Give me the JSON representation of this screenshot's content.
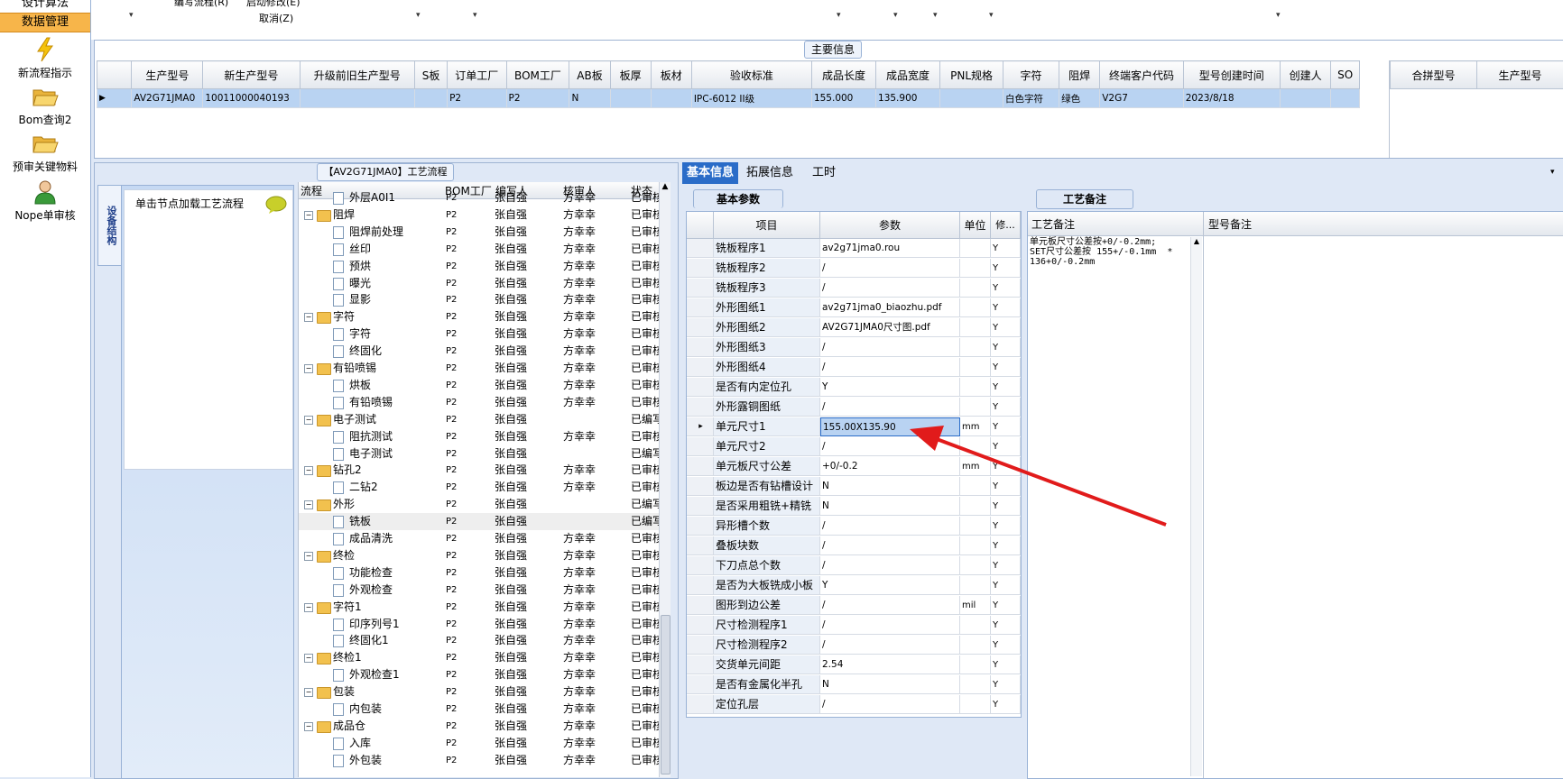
{
  "leftnav": {
    "top_item": "设计算法",
    "active_item": "数据管理",
    "items": [
      {
        "label": "新流程指示",
        "icon": "lightning-icon"
      },
      {
        "label": "Bom查询2",
        "icon": "folder-open-icon"
      },
      {
        "label": "预审关键物料",
        "icon": "folder-open-icon"
      },
      {
        "label": "Nope单审核",
        "icon": "user-icon"
      }
    ]
  },
  "toolbar": {
    "edit_process": "编写流程(R)",
    "start_modify": "启动修改(E)",
    "cancel": "取消(Z)"
  },
  "main_info": {
    "title": "主要信息",
    "columns": [
      "生产型号",
      "新生产型号",
      "升级前旧生产型号",
      "S板",
      "订单工厂",
      "BOM工厂",
      "AB板",
      "板厚",
      "板材",
      "验收标准",
      "成品长度",
      "成品宽度",
      "PNL规格",
      "字符",
      "阻焊",
      "终端客户代码",
      "型号创建时间",
      "创建人",
      "SO"
    ],
    "row": [
      "AV2G71JMA0",
      "10011000040193",
      "",
      "",
      "P2",
      "P2",
      "N",
      "",
      "",
      "IPC-6012 II级",
      "155.000",
      "135.900",
      "",
      "白色字符",
      "绿色",
      "V2G7",
      "2023/8/18",
      "",
      ""
    ],
    "side_columns": [
      "合拼型号",
      "生产型号"
    ]
  },
  "process_panel": {
    "title": "【AV2G71JMA0】工艺流程",
    "device_tab": "设备结构",
    "device_hint": "单击节点加载工艺流程",
    "columns": [
      "流程",
      "BOM工厂",
      "编写人",
      "核审人",
      "状态"
    ],
    "rows": [
      {
        "level": 2,
        "type": "doc",
        "name": "外层A0I1",
        "factory": "P2",
        "writer": "张自强",
        "reviewer": "方幸幸",
        "status": "已审核"
      },
      {
        "level": 1,
        "type": "folder",
        "name": "阻焊",
        "factory": "P2",
        "writer": "张自强",
        "reviewer": "方幸幸",
        "status": "已审核"
      },
      {
        "level": 2,
        "type": "doc",
        "name": "阻焊前处理",
        "factory": "P2",
        "writer": "张自强",
        "reviewer": "方幸幸",
        "status": "已审核"
      },
      {
        "level": 2,
        "type": "doc",
        "name": "丝印",
        "factory": "P2",
        "writer": "张自强",
        "reviewer": "方幸幸",
        "status": "已审核"
      },
      {
        "level": 2,
        "type": "doc",
        "name": "预烘",
        "factory": "P2",
        "writer": "张自强",
        "reviewer": "方幸幸",
        "status": "已审核"
      },
      {
        "level": 2,
        "type": "doc",
        "name": "曝光",
        "factory": "P2",
        "writer": "张自强",
        "reviewer": "方幸幸",
        "status": "已审核"
      },
      {
        "level": 2,
        "type": "doc",
        "name": "显影",
        "factory": "P2",
        "writer": "张自强",
        "reviewer": "方幸幸",
        "status": "已审核"
      },
      {
        "level": 1,
        "type": "folder",
        "name": "字符",
        "factory": "P2",
        "writer": "张自强",
        "reviewer": "方幸幸",
        "status": "已审核"
      },
      {
        "level": 2,
        "type": "doc",
        "name": "字符",
        "factory": "P2",
        "writer": "张自强",
        "reviewer": "方幸幸",
        "status": "已审核"
      },
      {
        "level": 2,
        "type": "doc",
        "name": "终固化",
        "factory": "P2",
        "writer": "张自强",
        "reviewer": "方幸幸",
        "status": "已审核"
      },
      {
        "level": 1,
        "type": "folder",
        "name": "有铅喷锡",
        "factory": "P2",
        "writer": "张自强",
        "reviewer": "方幸幸",
        "status": "已审核"
      },
      {
        "level": 2,
        "type": "doc",
        "name": "烘板",
        "factory": "P2",
        "writer": "张自强",
        "reviewer": "方幸幸",
        "status": "已审核"
      },
      {
        "level": 2,
        "type": "doc",
        "name": "有铅喷锡",
        "factory": "P2",
        "writer": "张自强",
        "reviewer": "方幸幸",
        "status": "已审核"
      },
      {
        "level": 1,
        "type": "folder",
        "name": "电子测试",
        "factory": "P2",
        "writer": "张自强",
        "reviewer": "",
        "status": "已编写"
      },
      {
        "level": 2,
        "type": "doc",
        "name": "阻抗测试",
        "factory": "P2",
        "writer": "张自强",
        "reviewer": "方幸幸",
        "status": "已审核"
      },
      {
        "level": 2,
        "type": "doc",
        "name": "电子测试",
        "factory": "P2",
        "writer": "张自强",
        "reviewer": "",
        "status": "已编写"
      },
      {
        "level": 1,
        "type": "folder",
        "name": "钻孔2",
        "factory": "P2",
        "writer": "张自强",
        "reviewer": "方幸幸",
        "status": "已审核"
      },
      {
        "level": 2,
        "type": "doc",
        "name": "二钻2",
        "factory": "P2",
        "writer": "张自强",
        "reviewer": "方幸幸",
        "status": "已审核"
      },
      {
        "level": 1,
        "type": "folder",
        "name": "外形",
        "factory": "P2",
        "writer": "张自强",
        "reviewer": "",
        "status": "已编写"
      },
      {
        "level": 2,
        "type": "doc",
        "name": "铣板",
        "factory": "P2",
        "writer": "张自强",
        "reviewer": "",
        "status": "已编写"
      },
      {
        "level": 2,
        "type": "doc",
        "name": "成品清洗",
        "factory": "P2",
        "writer": "张自强",
        "reviewer": "方幸幸",
        "status": "已审核"
      },
      {
        "level": 1,
        "type": "folder",
        "name": "终检",
        "factory": "P2",
        "writer": "张自强",
        "reviewer": "方幸幸",
        "status": "已审核"
      },
      {
        "level": 2,
        "type": "doc",
        "name": "功能检查",
        "factory": "P2",
        "writer": "张自强",
        "reviewer": "方幸幸",
        "status": "已审核"
      },
      {
        "level": 2,
        "type": "doc",
        "name": "外观检查",
        "factory": "P2",
        "writer": "张自强",
        "reviewer": "方幸幸",
        "status": "已审核"
      },
      {
        "level": 1,
        "type": "folder",
        "name": "字符1",
        "factory": "P2",
        "writer": "张自强",
        "reviewer": "方幸幸",
        "status": "已审核"
      },
      {
        "level": 2,
        "type": "doc",
        "name": "印序列号1",
        "factory": "P2",
        "writer": "张自强",
        "reviewer": "方幸幸",
        "status": "已审核"
      },
      {
        "level": 2,
        "type": "doc",
        "name": "终固化1",
        "factory": "P2",
        "writer": "张自强",
        "reviewer": "方幸幸",
        "status": "已审核"
      },
      {
        "level": 1,
        "type": "folder",
        "name": "终检1",
        "factory": "P2",
        "writer": "张自强",
        "reviewer": "方幸幸",
        "status": "已审核"
      },
      {
        "level": 2,
        "type": "doc",
        "name": "外观检查1",
        "factory": "P2",
        "writer": "张自强",
        "reviewer": "方幸幸",
        "status": "已审核"
      },
      {
        "level": 1,
        "type": "folder",
        "name": "包装",
        "factory": "P2",
        "writer": "张自强",
        "reviewer": "方幸幸",
        "status": "已审核"
      },
      {
        "level": 2,
        "type": "doc",
        "name": "内包装",
        "factory": "P2",
        "writer": "张自强",
        "reviewer": "方幸幸",
        "status": "已审核"
      },
      {
        "level": 1,
        "type": "folder",
        "name": "成品仓",
        "factory": "P2",
        "writer": "张自强",
        "reviewer": "方幸幸",
        "status": "已审核"
      },
      {
        "level": 2,
        "type": "doc",
        "name": "入库",
        "factory": "P2",
        "writer": "张自强",
        "reviewer": "方幸幸",
        "status": "已审核"
      },
      {
        "level": 2,
        "type": "doc",
        "name": "外包装",
        "factory": "P2",
        "writer": "张自强",
        "reviewer": "方幸幸",
        "status": "已审核"
      }
    ],
    "selected_row": "铣板"
  },
  "detail_tabs": [
    "基本信息",
    "拓展信息",
    "工时"
  ],
  "basic_params": {
    "title": "基本参数",
    "columns": [
      "项目",
      "参数",
      "单位",
      "修..."
    ],
    "rows": [
      {
        "item": "铣板程序1",
        "value": "av2g71jma0.rou",
        "unit": "",
        "mod": "Y"
      },
      {
        "item": "铣板程序2",
        "value": "/",
        "unit": "",
        "mod": "Y"
      },
      {
        "item": "铣板程序3",
        "value": "/",
        "unit": "",
        "mod": "Y"
      },
      {
        "item": "外形图纸1",
        "value": "av2g71jma0_biaozhu.pdf",
        "unit": "",
        "mod": "Y"
      },
      {
        "item": "外形图纸2",
        "value": "AV2G71JMA0尺寸图.pdf",
        "unit": "",
        "mod": "Y"
      },
      {
        "item": "外形图纸3",
        "value": "/",
        "unit": "",
        "mod": "Y"
      },
      {
        "item": "外形图纸4",
        "value": "/",
        "unit": "",
        "mod": "Y"
      },
      {
        "item": "是否有内定位孔",
        "value": "Y",
        "unit": "",
        "mod": "Y"
      },
      {
        "item": "外形露铜图纸",
        "value": "/",
        "unit": "",
        "mod": "Y"
      },
      {
        "item": "单元尺寸1",
        "value": "155.00X135.90",
        "unit": "mm",
        "mod": "Y"
      },
      {
        "item": "单元尺寸2",
        "value": "/",
        "unit": "",
        "mod": "Y"
      },
      {
        "item": "单元板尺寸公差",
        "value": "+0/-0.2",
        "unit": "mm",
        "mod": "Y"
      },
      {
        "item": "板边是否有钻槽设计",
        "value": "N",
        "unit": "",
        "mod": "Y"
      },
      {
        "item": "是否采用粗铣+精铣",
        "value": "N",
        "unit": "",
        "mod": "Y"
      },
      {
        "item": "异形槽个数",
        "value": "/",
        "unit": "",
        "mod": "Y"
      },
      {
        "item": "叠板块数",
        "value": "/",
        "unit": "",
        "mod": "Y"
      },
      {
        "item": "下刀点总个数",
        "value": "/",
        "unit": "",
        "mod": "Y"
      },
      {
        "item": "是否为大板铣成小板",
        "value": "Y",
        "unit": "",
        "mod": "Y"
      },
      {
        "item": "图形到边公差",
        "value": "/",
        "unit": "mil",
        "mod": "Y"
      },
      {
        "item": "尺寸检测程序1",
        "value": "/",
        "unit": "",
        "mod": "Y"
      },
      {
        "item": "尺寸检测程序2",
        "value": "/",
        "unit": "",
        "mod": "Y"
      },
      {
        "item": "交货单元间距",
        "value": "2.54",
        "unit": "",
        "mod": "Y"
      },
      {
        "item": "是否有金属化半孔",
        "value": "N",
        "unit": "",
        "mod": "Y"
      },
      {
        "item": "定位孔层",
        "value": "/",
        "unit": "",
        "mod": "Y"
      }
    ],
    "selected_row": "单元尺寸1"
  },
  "notes": {
    "tab_title": "工艺备注",
    "col1": "工艺备注",
    "col2": "型号备注",
    "text": "单元板尺寸公差按+0/-0.2mm;\nSET尺寸公差按 155+/-0.1mm  *\n136+0/-0.2mm"
  },
  "colors": {
    "selection": "#b9d3f2",
    "tab_active": "#2a6cc8",
    "arrow": "#e11b1b"
  }
}
